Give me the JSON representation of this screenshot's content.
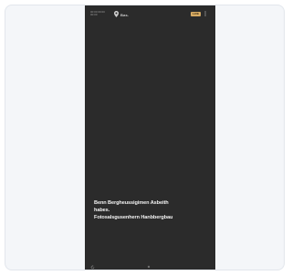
{
  "status_bar": {
    "left_line_1": "00:00 00:00",
    "left_line_2": "00:00",
    "brand": "Bas.",
    "badge": "LIVE"
  },
  "caption": {
    "line_1": "Benn Bergheussigimen Asbeith",
    "line_2": "habes.",
    "line_3": "Fotosalsgusenhern Hanbbergbau"
  },
  "icons": {
    "pin": "location-pin-icon",
    "menu": "more-vertical-icon",
    "bottom_left": "refresh-icon",
    "bottom_center": "dot-indicator-icon"
  },
  "colors": {
    "phone_bg": "#2b2b2b",
    "badge_bg": "#d7ab63",
    "card_bg": "#f4f6f9",
    "caption_text": "#f2f2f2"
  }
}
